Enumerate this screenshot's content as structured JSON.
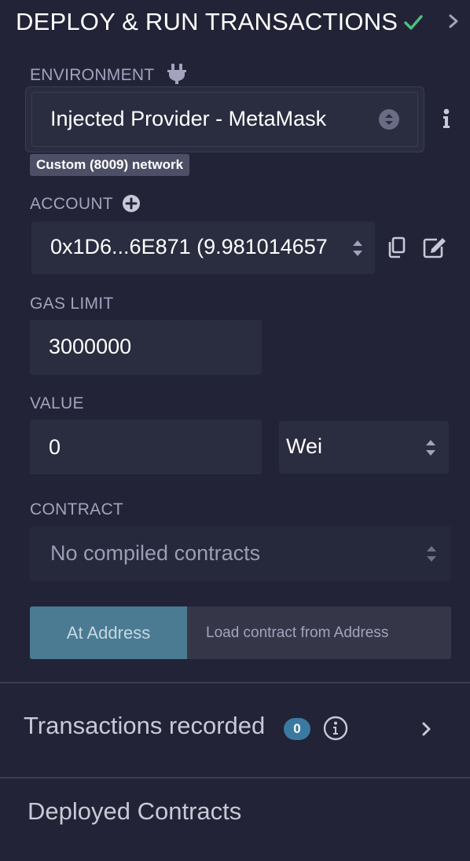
{
  "header": {
    "title": "DEPLOY & RUN TRANSACTIONS",
    "check_icon": "check-icon",
    "chevron_icon": "chevron-right-icon"
  },
  "environment": {
    "label": "ENVIRONMENT",
    "plug_icon": "plug-icon",
    "selected": "Injected Provider - MetaMask",
    "info_icon": "info-icon",
    "network_badge": "Custom (8009) network"
  },
  "account": {
    "label": "ACCOUNT",
    "add_icon": "plus-circle-icon",
    "selected": "0x1D6...6E871 (9.981014657",
    "copy_icon": "copy-icon",
    "edit_icon": "edit-icon"
  },
  "gas_limit": {
    "label": "GAS LIMIT",
    "value": "3000000"
  },
  "value": {
    "label": "VALUE",
    "amount": "0",
    "unit": "Wei"
  },
  "contract": {
    "label": "CONTRACT",
    "selected": "No compiled contracts"
  },
  "at_address": {
    "button_label": "At Address",
    "placeholder": "Load contract from Address"
  },
  "transactions_recorded": {
    "label": "Transactions recorded",
    "count": "0"
  },
  "deployed_contracts": {
    "label": "Deployed Contracts"
  },
  "colors": {
    "background": "#222336",
    "input_bg": "#2a2c3f",
    "accent_button": "#4a7b93",
    "check_green": "#4fbf7e",
    "badge_blue": "#3b7aa0"
  }
}
